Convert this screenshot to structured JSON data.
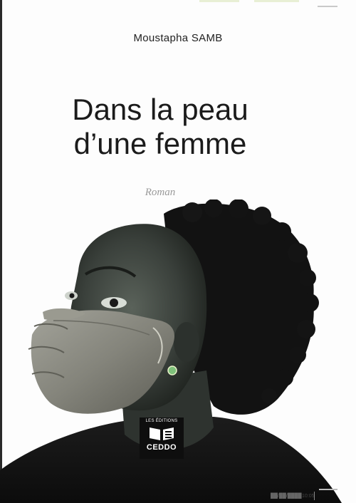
{
  "book": {
    "author": "Moustapha SAMB",
    "title_line1": "Dans la peau",
    "title_line2": "d’une femme",
    "genre": "Roman"
  },
  "publisher": {
    "label_small": "LES ÉDITIONS",
    "name": "CEDDO"
  },
  "print_marks": {
    "code": "██/██/████",
    "time": "10:05"
  },
  "colors": {
    "background": "#fdfdfd",
    "title": "#1b1b1b",
    "genre": "#9a9a9a",
    "skin": "#3a3f3a",
    "hair": "#111111",
    "hand": "#8a8a82",
    "earring": "#7ec07a"
  }
}
